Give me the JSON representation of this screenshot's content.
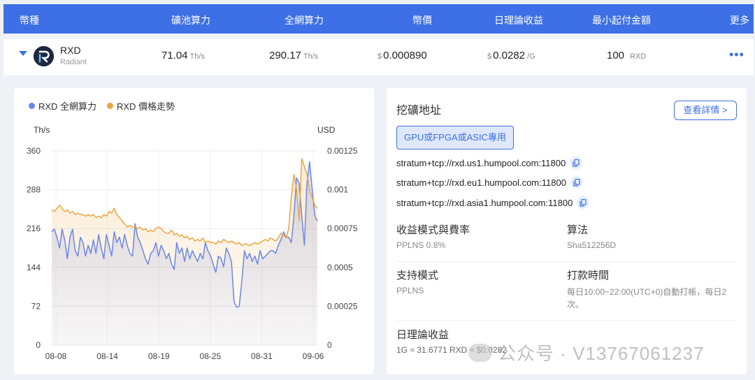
{
  "header": {
    "cols": [
      "幣種",
      "礦池算力",
      "全網算力",
      "幣價",
      "日理論收益",
      "最小起付金額",
      "更多"
    ]
  },
  "coin": {
    "symbol": "RXD",
    "name": "Radiant",
    "pool_hashrate": "71.04",
    "pool_hashrate_unit": "Th/s",
    "network_hashrate": "290.17",
    "network_hashrate_unit": "Th/s",
    "price_prefix": "$",
    "price": "0.000890",
    "income_prefix": "$",
    "income": "0.0282",
    "income_unit": "/G",
    "min_payout": "100",
    "min_payout_unit": "RXD",
    "more_icon": "ellipsis-icon"
  },
  "legend": {
    "hashrate": "RXD 全網算力",
    "price": "RXD 價格走勢"
  },
  "axis": {
    "left_unit": "Th/s",
    "right_unit": "USD"
  },
  "colors": {
    "accent": "#3d6fe6",
    "hashrate_line": "#6b86e8",
    "price_line": "#eba640"
  },
  "chart_data": {
    "type": "line",
    "x_ticks": [
      "08-08",
      "08-14",
      "08-19",
      "08-25",
      "08-31",
      "09-06"
    ],
    "y_left": {
      "label": "Th/s",
      "ticks": [
        0,
        72,
        144,
        216,
        288,
        360
      ],
      "range": [
        0,
        360
      ]
    },
    "y_right": {
      "label": "USD",
      "ticks": [
        "0",
        "0.00025",
        "0.0005",
        "0.00075",
        "0.001",
        "0.00125"
      ],
      "range": [
        0,
        0.00125
      ]
    },
    "grid": true,
    "legend_position": "top-left",
    "series": [
      {
        "name": "RXD 全網算力",
        "axis": "left",
        "values": [
          210,
          215,
          200,
          180,
          215,
          195,
          160,
          200,
          215,
          175,
          165,
          200,
          190,
          165,
          185,
          170,
          195,
          170,
          205,
          180,
          160,
          205,
          185,
          165,
          210,
          190,
          200,
          180,
          205,
          185,
          170,
          165,
          225,
          200,
          190,
          175,
          160,
          150,
          170,
          175,
          190,
          165,
          185,
          175,
          160,
          170,
          150,
          140,
          190,
          170,
          180,
          155,
          180,
          160,
          175,
          165,
          155,
          170,
          160,
          190,
          175,
          165,
          150,
          135,
          165,
          160,
          145,
          180,
          170,
          155,
          80,
          70,
          72,
          120,
          175,
          160,
          170,
          155,
          165,
          150,
          175,
          160,
          165,
          170,
          175,
          175,
          170,
          185,
          195,
          210,
          200,
          200,
          190,
          240,
          310,
          300,
          240,
          185,
          300,
          340,
          290,
          240,
          230
        ]
      },
      {
        "name": "RXD 價格走勢",
        "axis": "right",
        "values": [
          0.00087,
          0.00086,
          0.00088,
          0.0009,
          0.00088,
          0.00086,
          0.00087,
          0.00085,
          0.00086,
          0.00084,
          0.00085,
          0.00084,
          0.00084,
          0.00083,
          0.00084,
          0.00083,
          0.00084,
          0.00082,
          0.00083,
          0.00082,
          0.00084,
          0.00083,
          0.00086,
          0.00085,
          0.00088,
          0.00084,
          0.00082,
          0.0008,
          0.00078,
          0.00076,
          0.00077,
          0.00076,
          0.00076,
          0.00075,
          0.00076,
          0.00074,
          0.00075,
          0.00073,
          0.00074,
          0.00073,
          0.00075,
          0.00076,
          0.00075,
          0.00073,
          0.00072,
          0.00072,
          0.00074,
          0.00071,
          0.00072,
          0.0007,
          0.00071,
          0.00069,
          0.0007,
          0.00068,
          0.00069,
          0.00067,
          0.00068,
          0.00067,
          0.00069,
          0.00066,
          0.00067,
          0.00066,
          0.00066,
          0.00065,
          0.00067,
          0.00066,
          0.00068,
          0.00067,
          0.00066,
          0.00067,
          0.00066,
          0.00065,
          0.00066,
          0.00064,
          0.00065,
          0.00065,
          0.00064,
          0.00065,
          0.00066,
          0.00065,
          0.00066,
          0.00067,
          0.00068,
          0.00067,
          0.00069,
          0.00068,
          0.00067,
          0.00069,
          0.00072,
          0.00071,
          0.00069,
          0.00075,
          0.00095,
          0.0011,
          0.001,
          0.0008,
          0.0012,
          0.00115,
          0.0011,
          0.001,
          0.00095,
          0.0009,
          0.00088
        ]
      }
    ]
  },
  "info": {
    "title": "挖礦地址",
    "details_button": "查看詳情 >",
    "device_tag": "GPU或FPGA或ASIC專用",
    "urls": [
      "stratum+tcp://rxd.us1.humpool.com:11800",
      "stratum+tcp://rxd.eu1.humpool.com:11800",
      "stratum+tcp://rxd.asia1.humpool.com:11800"
    ],
    "fee_label": "收益模式與費率",
    "fee_value": "PPLNS 0.8%",
    "algo_label": "算法",
    "algo_value": "Sha512256D",
    "mode_label": "支持模式",
    "mode_value": "PPLNS",
    "payout_label": "打款時間",
    "payout_value": "每日10:00~22:00(UTC+0)自動打帳，每日2次。",
    "income_label": "日理論收益",
    "income_value": "1G ≈ 31.6771 RXD ≈ $0.0282"
  },
  "watermark": "公众号 · V13767061237"
}
